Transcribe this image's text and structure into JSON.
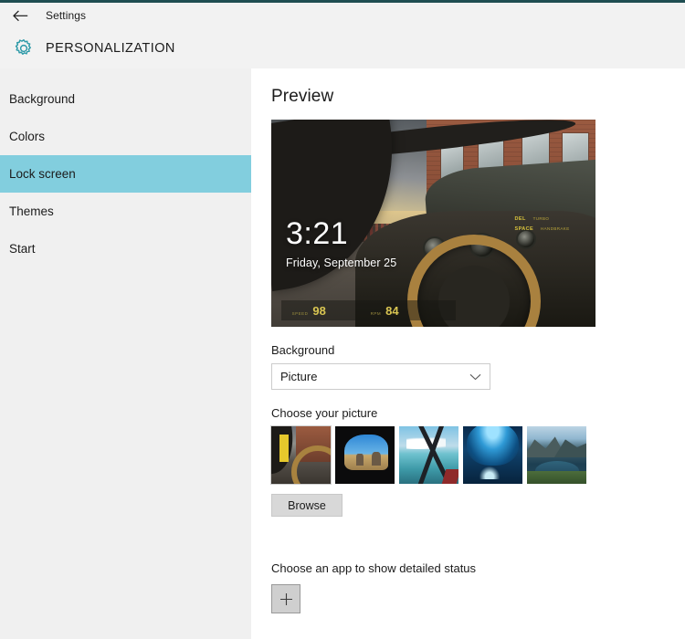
{
  "window": {
    "accent_color": "#1f4e52",
    "titlebar": {
      "back_label": "back-arrow",
      "title": "Settings"
    },
    "header": {
      "icon": "gear-icon",
      "title": "PERSONALIZATION",
      "icon_color": "#2e9aa8"
    }
  },
  "sidebar": {
    "selected_index": 2,
    "highlight_color": "#82cede",
    "items": [
      {
        "label": "Background"
      },
      {
        "label": "Colors"
      },
      {
        "label": "Lock screen"
      },
      {
        "label": "Themes"
      },
      {
        "label": "Start"
      }
    ]
  },
  "main": {
    "preview_heading": "Preview",
    "lock_screen": {
      "time": "3:21",
      "date": "Friday, September 25",
      "hud": {
        "stats": [
          {
            "label": "SPEED",
            "value": "98"
          },
          {
            "label": "RPM",
            "value": "84"
          }
        ],
        "keys": [
          {
            "key": "DEL",
            "desc": "TURBO"
          },
          {
            "key": "SPACE",
            "desc": "HANDBRAKE"
          }
        ]
      }
    },
    "background_field": {
      "label": "Background",
      "selected_option": "Picture",
      "chevron": "chevron-down-icon"
    },
    "choose_picture": {
      "label": "Choose your picture",
      "selected_index": 0,
      "thumbnails": [
        {
          "name": "car-street-scene"
        },
        {
          "name": "cave-beach-arch"
        },
        {
          "name": "sky-water-frame"
        },
        {
          "name": "blue-ice-cave"
        },
        {
          "name": "mountain-lake"
        }
      ],
      "browse_label": "Browse"
    },
    "detailed_status": {
      "label": "Choose an app to show detailed status",
      "add_label": "+"
    }
  }
}
